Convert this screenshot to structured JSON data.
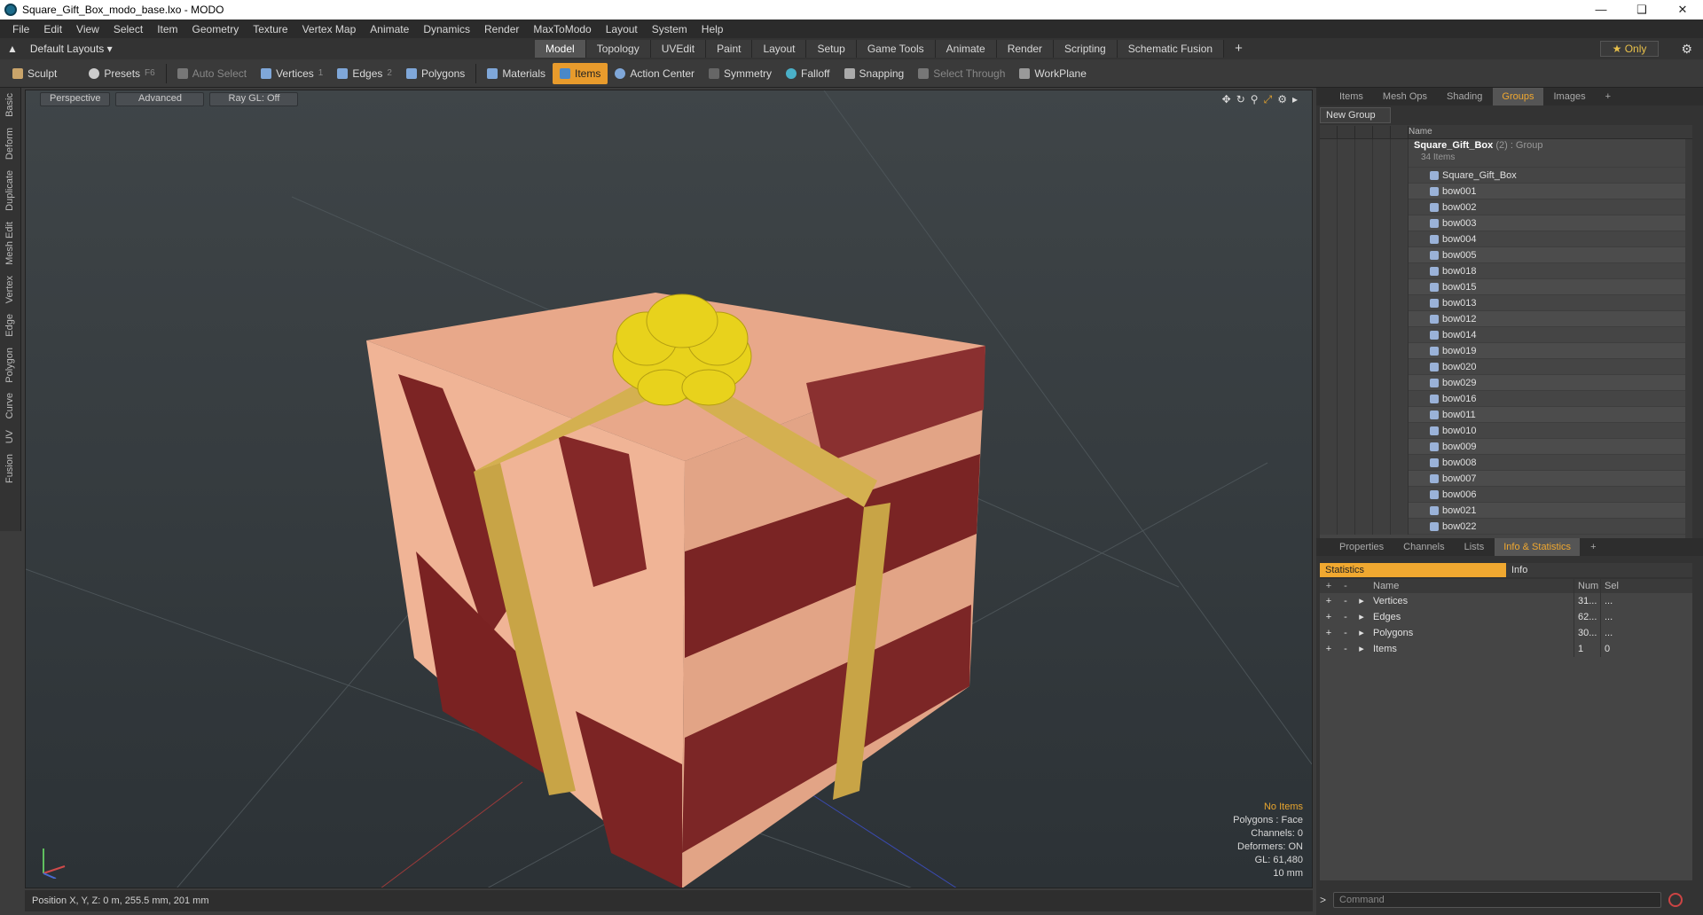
{
  "window": {
    "title": "Square_Gift_Box_modo_base.lxo - MODO"
  },
  "menu": [
    "File",
    "Edit",
    "View",
    "Select",
    "Item",
    "Geometry",
    "Texture",
    "Vertex Map",
    "Animate",
    "Dynamics",
    "Render",
    "MaxToModo",
    "Layout",
    "System",
    "Help"
  ],
  "layout_selector": "Default Layouts",
  "mode_tabs": [
    {
      "label": "Model",
      "active": true
    },
    {
      "label": "Topology"
    },
    {
      "label": "UVEdit"
    },
    {
      "label": "Paint"
    },
    {
      "label": "Layout"
    },
    {
      "label": "Setup"
    },
    {
      "label": "Game Tools"
    },
    {
      "label": "Animate"
    },
    {
      "label": "Render"
    },
    {
      "label": "Scripting"
    },
    {
      "label": "Schematic Fusion"
    }
  ],
  "only_button": "Only",
  "toolbar": {
    "sculpt": "Sculpt",
    "presets": "Presets",
    "presets_key": "F6",
    "auto_select": "Auto Select",
    "vertices": "Vertices",
    "vertices_key": "1",
    "edges": "Edges",
    "edges_key": "2",
    "polygons": "Polygons",
    "materials": "Materials",
    "items": "Items",
    "action_center": "Action Center",
    "symmetry": "Symmetry",
    "falloff": "Falloff",
    "snapping": "Snapping",
    "select_through": "Select Through",
    "workplane": "WorkPlane"
  },
  "left_tabs": [
    "Basic",
    "Deform",
    "Duplicate",
    "Mesh Edit",
    "Vertex",
    "Edge",
    "Polygon",
    "Curve",
    "UV",
    "Fusion"
  ],
  "viewport": {
    "perspective": "Perspective",
    "advanced": "Advanced",
    "raygl": "Ray GL: Off",
    "info": {
      "no_items": "No Items",
      "polygons": "Polygons : Face",
      "channels": "Channels: 0",
      "deformers": "Deformers: ON",
      "gl": "GL: 61,480",
      "scale": "10 mm"
    }
  },
  "status": "Position X, Y, Z:  0 m, 255.5 mm, 201 mm",
  "top_panel_tabs": [
    {
      "label": "Items"
    },
    {
      "label": "Mesh Ops"
    },
    {
      "label": "Shading"
    },
    {
      "label": "Groups",
      "active": true
    },
    {
      "label": "Images"
    }
  ],
  "groups": {
    "new_group": "New Group",
    "name_header": "Name",
    "root_name": "Square_Gift_Box",
    "root_suffix": "(2) : Group",
    "root_count": "34 Items",
    "items": [
      "Square_Gift_Box",
      "bow001",
      "bow002",
      "bow003",
      "bow004",
      "bow005",
      "bow018",
      "bow015",
      "bow013",
      "bow012",
      "bow014",
      "bow019",
      "bow020",
      "bow029",
      "bow016",
      "bow011",
      "bow010",
      "bow009",
      "bow008",
      "bow007",
      "bow006",
      "bow021",
      "bow022"
    ]
  },
  "bottom_panel_tabs": [
    {
      "label": "Properties"
    },
    {
      "label": "Channels"
    },
    {
      "label": "Lists"
    },
    {
      "label": "Info & Statistics",
      "active": true
    }
  ],
  "stats": {
    "tab_statistics": "Statistics",
    "tab_info": "Info",
    "headers": {
      "name": "Name",
      "num": "Num",
      "sel": "Sel"
    },
    "rows": [
      {
        "name": "Vertices",
        "num": "31...",
        "sel": "..."
      },
      {
        "name": "Edges",
        "num": "62...",
        "sel": "..."
      },
      {
        "name": "Polygons",
        "num": "30...",
        "sel": "..."
      },
      {
        "name": "Items",
        "num": "1",
        "sel": "0"
      }
    ]
  },
  "command": {
    "placeholder": "Command"
  }
}
